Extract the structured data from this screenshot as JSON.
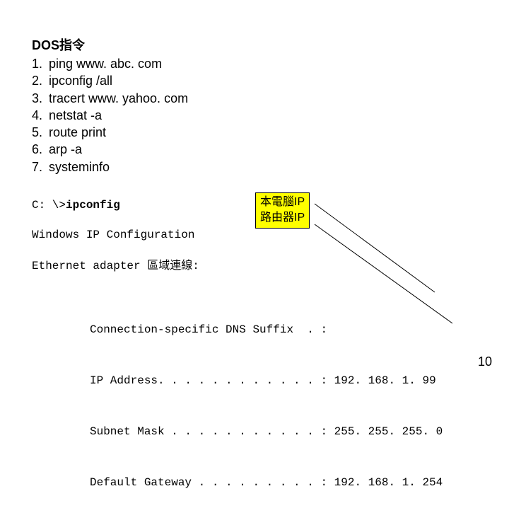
{
  "heading": "DOS指令",
  "commands": {
    "n1": "1.",
    "c1": "ping www. abc. com",
    "n2": "2.",
    "c2": "ipconfig /all",
    "n3": "3.",
    "c3": "tracert www. yahoo. com",
    "n4": "4.",
    "c4": "netstat -a",
    "n5": "5.",
    "c5": "route print",
    "n6": "6.",
    "c6": "arp -a",
    "n7": "7.",
    "c7": "systeminfo"
  },
  "terminal": {
    "prompt_prefix": "C: \\>",
    "prompt_cmd": "ipconfig",
    "config_header": "Windows IP Configuration",
    "adapter_header": "Ethernet adapter 區域連線:",
    "rows": {
      "r1": "Connection-specific DNS Suffix  . :",
      "r2": "IP Address. . . . . . . . . . . . : 192. 168. 1. 99",
      "r3": "Subnet Mask . . . . . . . . . . . : 255. 255. 255. 0",
      "r4": "Default Gateway . . . . . . . . . : 192. 168. 1. 254"
    }
  },
  "callout": {
    "line1": "本電腦IP",
    "line2": "路由器IP"
  },
  "page_number": "10"
}
